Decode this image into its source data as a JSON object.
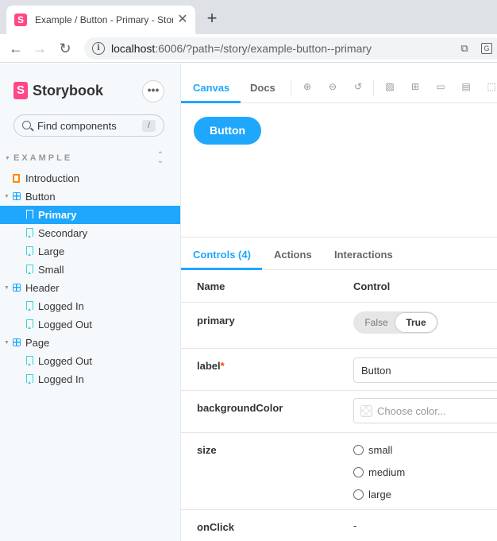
{
  "browser": {
    "tab_title": "Example / Button - Primary - Storybook",
    "favicon_letter": "S",
    "url_host": "localhost",
    "url_rest": ":6006/?path=/story/example-button--primary"
  },
  "sidebar": {
    "logo_letter": "S",
    "brand": "Storybook",
    "menu_glyph": "•••",
    "search_placeholder": "Find components",
    "search_shortcut": "/",
    "section": "EXAMPLE",
    "tree": [
      {
        "label": "Introduction",
        "kind": "doc",
        "level": 0
      },
      {
        "label": "Button",
        "kind": "component",
        "level": 0
      },
      {
        "label": "Primary",
        "kind": "story",
        "level": 1,
        "active": true
      },
      {
        "label": "Secondary",
        "kind": "story",
        "level": 1
      },
      {
        "label": "Large",
        "kind": "story",
        "level": 1
      },
      {
        "label": "Small",
        "kind": "story",
        "level": 1
      },
      {
        "label": "Header",
        "kind": "component",
        "level": 0
      },
      {
        "label": "Logged In",
        "kind": "story",
        "level": 1
      },
      {
        "label": "Logged Out",
        "kind": "story",
        "level": 1
      },
      {
        "label": "Page",
        "kind": "component",
        "level": 0
      },
      {
        "label": "Logged Out",
        "kind": "story",
        "level": 1
      },
      {
        "label": "Logged In",
        "kind": "story",
        "level": 1
      }
    ]
  },
  "toolbar": {
    "tab_canvas": "Canvas",
    "tab_docs": "Docs"
  },
  "preview": {
    "button_label": "Button"
  },
  "addons": {
    "tab_controls": "Controls (4)",
    "tab_actions": "Actions",
    "tab_interactions": "Interactions",
    "col_name": "Name",
    "col_control": "Control"
  },
  "controls": {
    "primary": {
      "name": "primary",
      "false_label": "False",
      "true_label": "True"
    },
    "label": {
      "name": "label",
      "required_mark": "*",
      "value": "Button"
    },
    "background": {
      "name": "backgroundColor",
      "placeholder": "Choose color..."
    },
    "size": {
      "name": "size",
      "options": [
        "small",
        "medium",
        "large"
      ]
    },
    "onclick": {
      "name": "onClick",
      "value": "-"
    }
  },
  "colors": {
    "accent": "#1ea7fd",
    "brand": "#ff4785",
    "sidebar_bg": "#f6f9fc"
  }
}
